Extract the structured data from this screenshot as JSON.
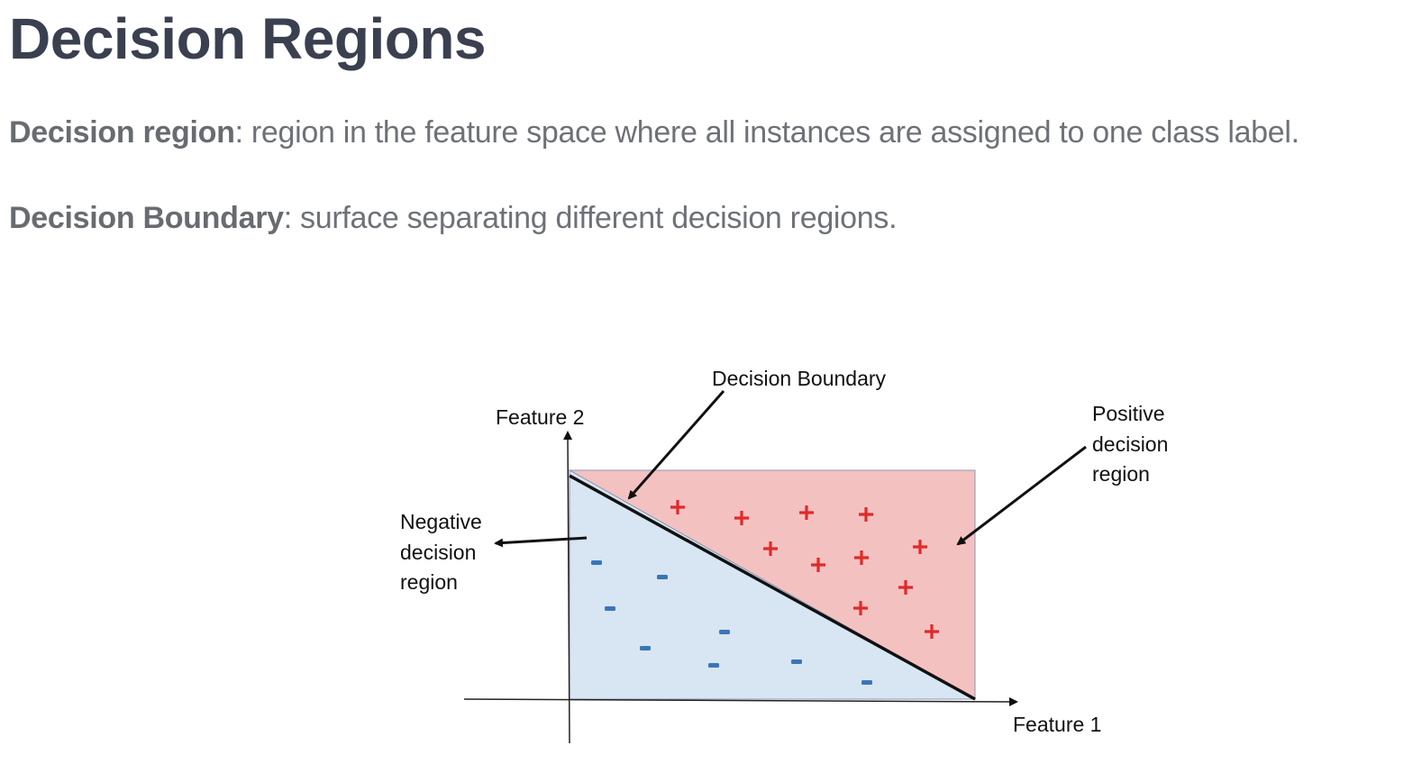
{
  "title": "Decision Regions",
  "definitions": [
    {
      "term": "Decision region",
      "text": ": region in the feature space where all instances are assigned to one class label."
    },
    {
      "term": "Decision Boundary",
      "text": ": surface separating different decision regions."
    }
  ],
  "diagram": {
    "x_axis_label": "Feature 1",
    "y_axis_label": "Feature 2",
    "boundary_label": "Decision Boundary",
    "positive_label": [
      "Positive",
      "decision",
      "region"
    ],
    "negative_label": [
      "Negative",
      "decision",
      "region"
    ],
    "positive_marker": "+",
    "negative_marker": "-",
    "colors": {
      "positive_region": "#f4c1c1",
      "negative_region": "#d8e5f3",
      "positive_marker": "#e02a2a",
      "negative_marker": "#3a76b5",
      "boundary": "#111111"
    }
  }
}
